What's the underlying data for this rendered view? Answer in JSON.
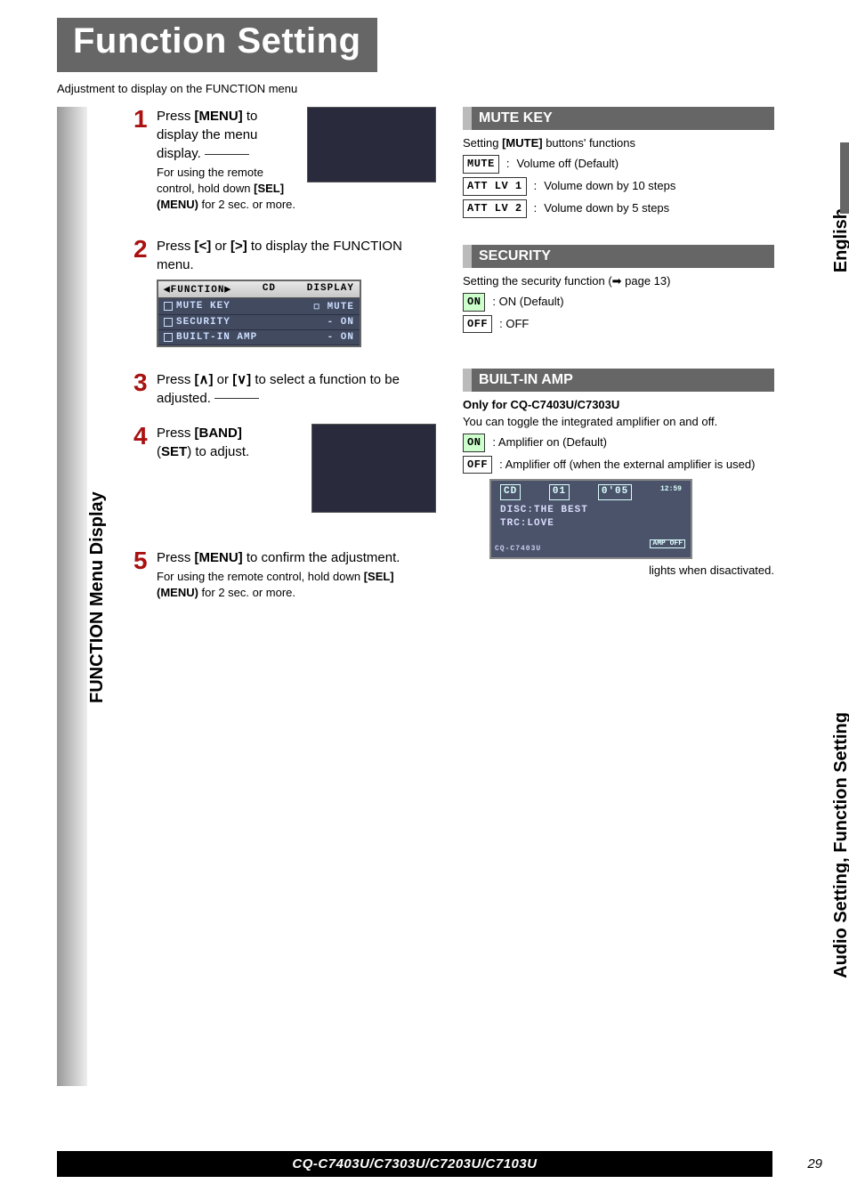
{
  "header": {
    "title": "Function Setting",
    "subtitle": "Adjustment to display on the FUNCTION menu"
  },
  "sidebars": {
    "left1": "FUNCTION Menu Display",
    "right1": "English",
    "right2": "Audio Setting, Function Setting"
  },
  "steps": {
    "s1_main_a": "Press ",
    "s1_main_b": "[MENU]",
    "s1_main_c": " to display the menu display.",
    "s1_sub_a": "For using the remote control, hold down ",
    "s1_sub_b": "[SEL] (MENU)",
    "s1_sub_c": " for 2 sec. or more.",
    "s2_main_a": "Press ",
    "s2_main_b": "[<]",
    "s2_main_c": " or ",
    "s2_main_d": "[>]",
    "s2_main_e": " to display the FUNCTION menu.",
    "s3_main_a": "Press ",
    "s3_main_b": "[∧]",
    "s3_main_c": " or ",
    "s3_main_d": "[∨]",
    "s3_main_e": " to select a function to be adjusted.",
    "s4_main_a": "Press ",
    "s4_main_b": "[BAND]",
    "s4_main_c": " (",
    "s4_main_d": "SET",
    "s4_main_e": ") to adjust.",
    "s5_main_a": "Press ",
    "s5_main_b": "[MENU]",
    "s5_main_c": " to confirm the adjustment.",
    "s5_sub_a": "For using the remote control, hold down ",
    "s5_sub_b": "[SEL] (MENU)",
    "s5_sub_c": " for 2 sec. or more."
  },
  "func_table": {
    "hdr_l": "◀FUNCTION▶",
    "hdr_m": "CD",
    "hdr_r": "DISPLAY",
    "r1_l": "MUTE KEY",
    "r1_r": "☐ MUTE",
    "r2_l": "SECURITY",
    "r2_r": "- ON",
    "r3_l": "BUILT-IN AMP",
    "r3_r": "- ON"
  },
  "sections": {
    "mute": {
      "title": "MUTE KEY",
      "intro_a": "Setting ",
      "intro_b": "[MUTE]",
      "intro_c": " buttons' functions",
      "opt1_icon": "MUTE",
      "opt1_txt": "Volume off (Default)",
      "opt2_icon": "ATT LV 1",
      "opt2_txt": "Volume down by 10 steps",
      "opt3_icon": "ATT LV 2",
      "opt3_txt": "Volume down by 5 steps"
    },
    "security": {
      "title": "SECURITY",
      "intro": "Setting the security function (➡ page 13)",
      "on_icon": "ON",
      "on_txt": ": ON (Default)",
      "off_icon": "OFF",
      "off_txt": ": OFF"
    },
    "amp": {
      "title": "BUILT-IN AMP",
      "only": "Only for CQ-C7403U/C7303U",
      "intro": "You can toggle the integrated amplifier on and off.",
      "on_icon": "ON",
      "on_txt": ": Amplifier on (Default)",
      "off_icon": "OFF",
      "off_txt": ": Amplifier off (when the external amplifier is used)",
      "lcd": {
        "cd": "CD",
        "trk": "01",
        "time": "0'05",
        "clock": "12:59",
        "disc": "DISC:THE BEST",
        "trc": "TRC:LOVE",
        "amp": "AMP\nOFF",
        "prod": "CQ-C7403U"
      },
      "caption": "lights when disactivated."
    }
  },
  "footer": {
    "model": "CQ-C7403U/C7303U/C7203U/C7103U",
    "page": "29"
  }
}
